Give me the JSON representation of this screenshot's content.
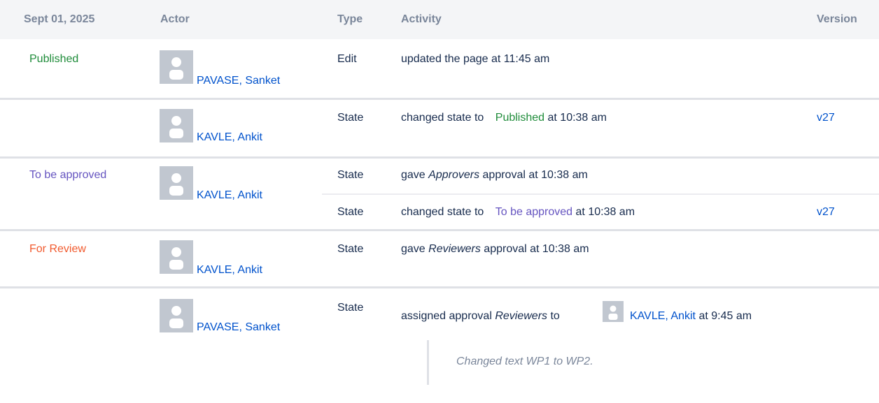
{
  "header": {
    "date": "Sept 01, 2025",
    "actor": "Actor",
    "type": "Type",
    "activity": "Activity",
    "version": "Version"
  },
  "rows": [
    {
      "state": "Published",
      "actor": "PAVASE, Sanket",
      "type": "Edit",
      "activity": "updated the page at 11:45 am",
      "version": ""
    },
    {
      "state": "",
      "actor": "KAVLE, Ankit",
      "type": "State",
      "activity_prefix": "changed state to",
      "activity_state": "Published",
      "activity_suffix": "at 10:38 am",
      "version": "v27"
    },
    {
      "state": "To be approved",
      "actor": "KAVLE, Ankit",
      "entries": [
        {
          "type": "State",
          "activity_prefix": "gave",
          "activity_italic": "Approvers",
          "activity_suffix": "approval at 10:38 am",
          "version": ""
        },
        {
          "type": "State",
          "activity_prefix": "changed state to",
          "activity_state": "To be approved",
          "activity_suffix": "at 10:38 am",
          "version": "v27"
        }
      ]
    },
    {
      "state": "For Review",
      "actor": "KAVLE, Ankit",
      "type": "State",
      "activity_prefix": "gave",
      "activity_italic": "Reviewers",
      "activity_suffix": "approval at 10:38 am",
      "version": ""
    },
    {
      "state": "",
      "actor": "PAVASE, Sanket",
      "type": "State",
      "activity_prefix": "assigned approval",
      "activity_italic": "Reviewers",
      "activity_to": "to",
      "activity_user": "KAVLE, Ankit",
      "activity_suffix": "at 9:45 am",
      "comment": "Changed text WP1 to WP2",
      "comment_end": ".",
      "version": ""
    }
  ],
  "colors": {
    "published": "#1f8c3a",
    "to_be_approved": "#6554c0",
    "for_review": "#f15b2f",
    "link": "#0052cc"
  },
  "icons": {
    "avatar": "default-user-avatar-icon"
  }
}
